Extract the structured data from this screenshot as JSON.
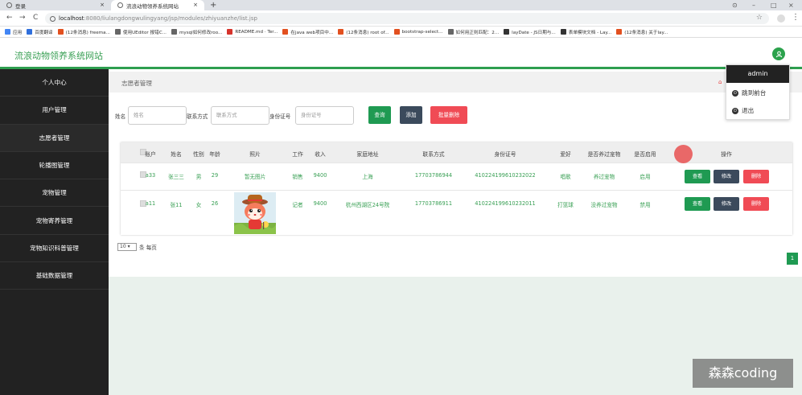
{
  "browser": {
    "tabs": [
      {
        "title": "登录",
        "close": "×"
      },
      {
        "title": "流浪动物领养系统网站",
        "close": "×"
      }
    ],
    "new_tab": "+",
    "window_controls": [
      "⊙",
      "–",
      "□",
      "×"
    ],
    "nav": {
      "back": "←",
      "forward": "→",
      "reload": "C"
    },
    "url_host": "localhost",
    "url_path": ":8080/liulangdongwulingyang/jsp/modules/zhiyuanzhe/list.jsp",
    "star": "☆",
    "menu": "⋮",
    "bookmarks": [
      {
        "label": "应用",
        "color": "#4285f4"
      },
      {
        "label": "百度翻译",
        "color": "#2f6fdc"
      },
      {
        "label": "(12条消息) freema...",
        "color": "#e2501f"
      },
      {
        "label": "使用UEditor 报错C...",
        "color": "#666666"
      },
      {
        "label": "mysql如何修改roo...",
        "color": "#666666"
      },
      {
        "label": "README.md · Ter...",
        "color": "#d6332b"
      },
      {
        "label": "在java web项目中...",
        "color": "#e2501f"
      },
      {
        "label": "(12条消息) root of...",
        "color": "#e2501f"
      },
      {
        "label": "bootstrap-select...",
        "color": "#e2501f"
      },
      {
        "label": "如何用正则匹配：2...",
        "color": "#666666"
      },
      {
        "label": "layDate - JS日期与...",
        "color": "#333333"
      },
      {
        "label": "表单模块文档 - Lay...",
        "color": "#333333"
      },
      {
        "label": "(12条消息) 关于lay...",
        "color": "#e2501f"
      }
    ]
  },
  "app": {
    "title": "流浪动物领养系统网站",
    "accent": "#2e9e4f",
    "user_icon": "&",
    "sidebar": [
      "个人中心",
      "用户管理",
      "志愿者管理",
      "轮播图管理",
      "宠物管理",
      "宠物寄养管理",
      "宠物知识科普管理",
      "基础数据管理"
    ],
    "breadcrumb": "志愿者管理",
    "breadcrumb_home": "⌂",
    "search": {
      "name_label": "姓名",
      "name_placeholder": "姓名",
      "phone_label": "联系方式",
      "phone_placeholder": "联系方式",
      "id_label": "身份证号",
      "id_placeholder": "身份证号",
      "query_btn": "查询",
      "add_btn": "添加",
      "batch_delete_btn": "批量删除"
    },
    "table": {
      "headers": [
        "账户",
        "姓名",
        "性别",
        "年龄",
        "照片",
        "工作",
        "收入",
        "家庭地址",
        "联系方式",
        "身份证号",
        "爱好",
        "是否养过宠物",
        "是否启用",
        "操作"
      ],
      "rows": [
        {
          "account": "a33",
          "name": "张三三",
          "gender": "男",
          "age": "29",
          "photo": "暂无图片",
          "job": "销售",
          "income": "9400",
          "address": "上海",
          "phone": "17703786944",
          "id_card": "410224199610232022",
          "hobby": "唱歌",
          "pet_before": "养过宠物",
          "enabled": "启用",
          "view": "查看",
          "edit": "修改",
          "delete": "删除"
        },
        {
          "account": "a11",
          "name": "张11",
          "gender": "女",
          "age": "26",
          "photo": "",
          "job": "记者",
          "income": "9400",
          "address": "杭州西湖区24号院",
          "phone": "17703786911",
          "id_card": "410224199610232011",
          "hobby": "打篮球",
          "pet_before": "没养过宠物",
          "enabled": "禁用",
          "view": "查看",
          "edit": "修改",
          "delete": "删除"
        }
      ]
    },
    "pager": {
      "per_page": "10",
      "select_arrow": "▾",
      "per_page_text": "条 每页",
      "current_page": "1"
    },
    "dropdown": {
      "user": "admin",
      "items": [
        {
          "icon": "⏻",
          "label": "跳到前台"
        },
        {
          "icon": "⏻",
          "label": "退出"
        }
      ]
    }
  },
  "watermark": "森森coding"
}
